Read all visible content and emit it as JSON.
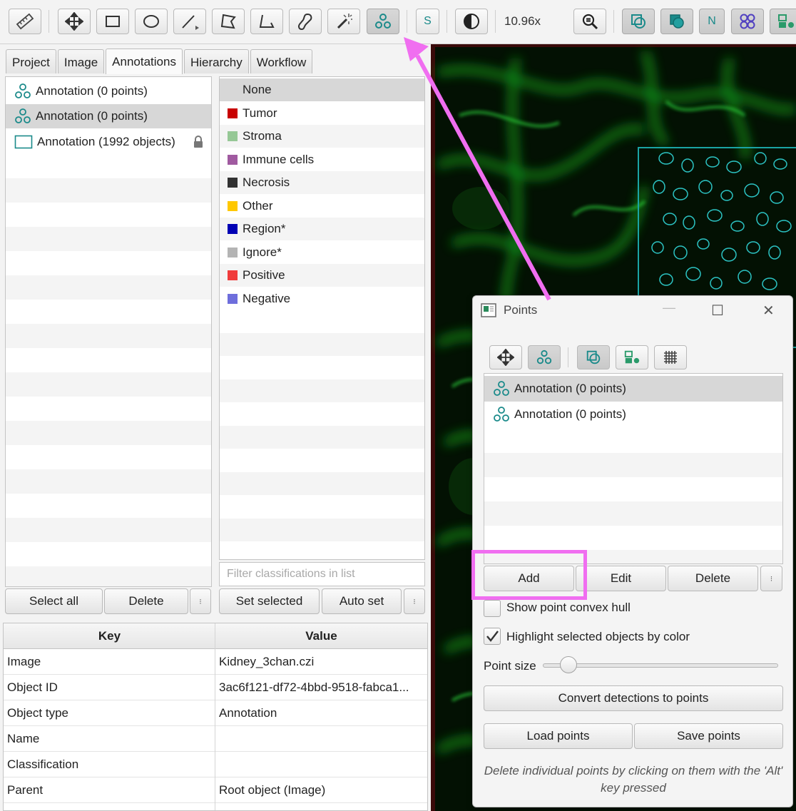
{
  "toolbar": {
    "zoom": "10.96x",
    "letters": {
      "s": "S",
      "n": "N"
    },
    "tools": [
      "ruler-icon",
      "move-icon",
      "rectangle-icon",
      "ellipse-icon",
      "line-icon",
      "polygon-icon",
      "polyline-icon",
      "brush-icon",
      "wand-icon",
      "points-icon",
      "selection-mode-icon",
      "contrast-icon",
      "zoom-fit-icon",
      "show-annotations-icon",
      "fill-annotations-icon",
      "show-names-icon",
      "show-detections-icon",
      "pixel-classification-icon"
    ],
    "accent": "#1a8a8a"
  },
  "tabs": [
    "Project",
    "Image",
    "Annotations",
    "Hierarchy",
    "Workflow"
  ],
  "active_tab": "Annotations",
  "annotations": [
    {
      "label": "Annotation (0 points)",
      "icon": "points-icon"
    },
    {
      "label": "Annotation (0 points)",
      "icon": "points-icon",
      "selected": true
    },
    {
      "label": "Annotation (1992 objects)",
      "icon": "rectangle-icon",
      "locked": true
    }
  ],
  "annotation_buttons": {
    "select_all": "Select all",
    "delete": "Delete",
    "more": "⁝"
  },
  "classifications": [
    {
      "label": "None",
      "color": null
    },
    {
      "label": "Tumor",
      "color": "#c80000"
    },
    {
      "label": "Stroma",
      "color": "#96c896"
    },
    {
      "label": "Immune cells",
      "color": "#a05aa0"
    },
    {
      "label": "Necrosis",
      "color": "#323232"
    },
    {
      "label": "Other",
      "color": "#ffc800"
    },
    {
      "label": "Region*",
      "color": "#0000b4"
    },
    {
      "label": "Ignore*",
      "color": "#b4b4b4"
    },
    {
      "label": "Positive",
      "color": "#f03c3c"
    },
    {
      "label": "Negative",
      "color": "#6e6edc"
    }
  ],
  "class_filter": {
    "placeholder": "Filter classifications in list"
  },
  "class_buttons": {
    "set_selected": "Set selected",
    "auto_set": "Auto set",
    "more": "⁝"
  },
  "properties": {
    "headers": {
      "key": "Key",
      "value": "Value"
    },
    "rows": [
      {
        "key": "Image",
        "value": "Kidney_3chan.czi"
      },
      {
        "key": "Object ID",
        "value": "3ac6f121-df72-4bbd-9518-fabca1..."
      },
      {
        "key": "Object type",
        "value": "Annotation"
      },
      {
        "key": "Name",
        "value": ""
      },
      {
        "key": "Classification",
        "value": ""
      },
      {
        "key": "Parent",
        "value": "Root object (Image)"
      }
    ]
  },
  "points_dialog": {
    "title": "Points",
    "window_controls": {
      "minimize": "—",
      "maximize": "☐",
      "close": "✕"
    },
    "list": [
      {
        "label": "Annotation (0 points)",
        "selected": true
      },
      {
        "label": "Annotation (0 points)"
      }
    ],
    "buttons": {
      "add": "Add",
      "edit": "Edit",
      "delete": "Delete",
      "more": "⁝"
    },
    "show_hull": {
      "label": "Show point convex hull",
      "checked": false
    },
    "highlight": {
      "label": "Highlight selected objects by color",
      "checked": true
    },
    "point_size": {
      "label": "Point size",
      "value": 0.08
    },
    "convert_button": "Convert detections to points",
    "load_button": "Load points",
    "save_button": "Save points",
    "note": "Delete individual points by clicking on them with the 'Alt' key pressed"
  },
  "overlay": {
    "highlight_color": "#f06ef0"
  }
}
